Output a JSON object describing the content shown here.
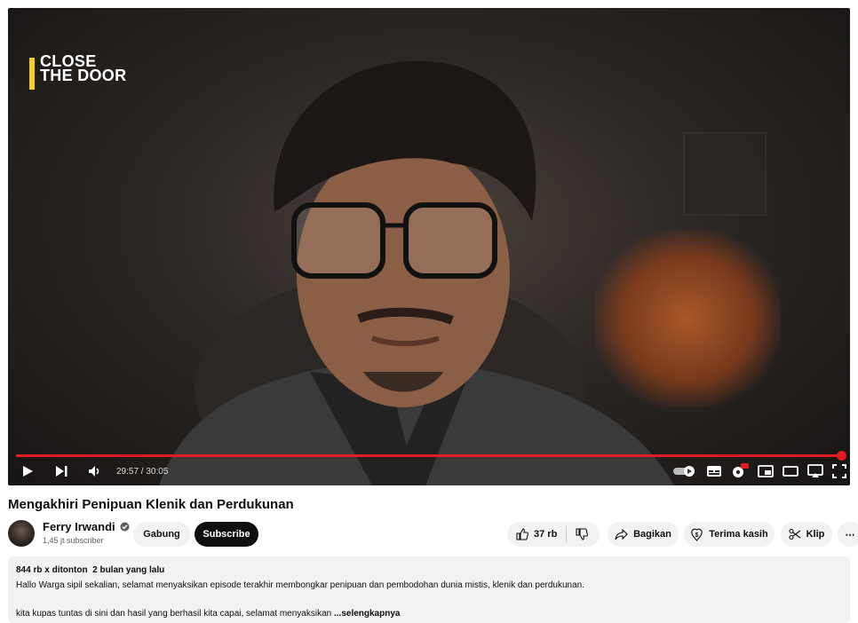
{
  "video": {
    "overlay_logo_line1": "CLOSE",
    "overlay_logo_line2": "THE DOOR",
    "time": "29:57 / 30:05",
    "progress_percent": 99.6
  },
  "title": "Mengakhiri Penipuan Klenik dan Perdukunan",
  "channel": {
    "name": "Ferry Irwandi",
    "subscribers": "1,45 jt subscriber",
    "join_label": "Gabung",
    "subscribe_label": "Subscribe"
  },
  "actions": {
    "likes": "37 rb",
    "share": "Bagikan",
    "thanks": "Terima kasih",
    "clip": "Klip",
    "more": "⋯"
  },
  "description": {
    "views": "844 rb x ditonton",
    "date": "2 bulan yang lalu",
    "line1": "Hallo Warga sipil sekalian, selamat menyaksikan episode terakhir membongkar penipuan dan pembodohan dunia mistis, klenik dan perdukunan.",
    "line2": "kita kupas tuntas di sini dan hasil yang berhasil kita capai, selamat menyaksikan",
    "more": "...selengkapnya"
  },
  "colors": {
    "accent": "#e21b23",
    "logo_bar": "#f3d21b"
  }
}
